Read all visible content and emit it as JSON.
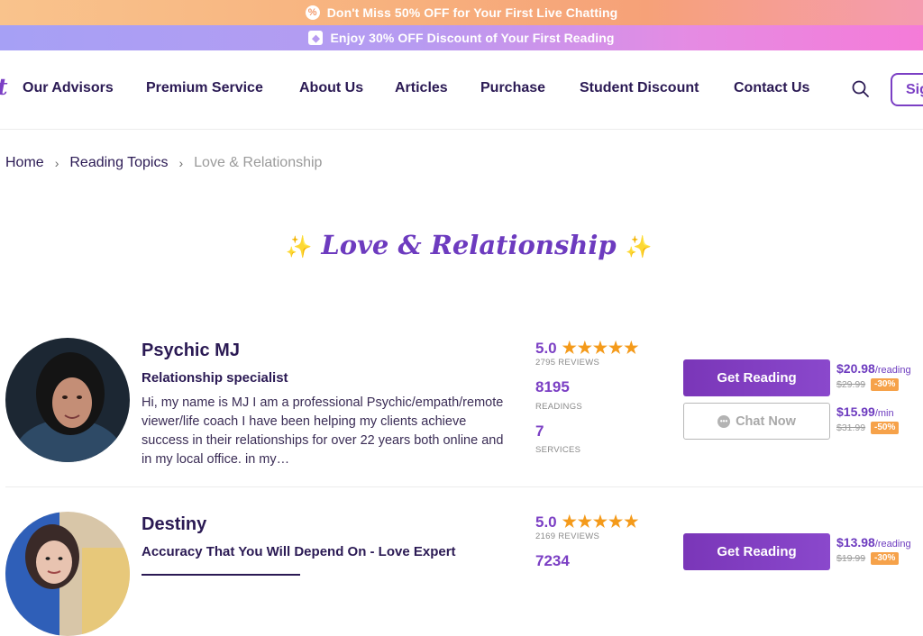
{
  "promo": {
    "line1": "Don't Miss 50% OFF for Your First Live Chatting",
    "line2": "Enjoy 30% OFF Discount of Your First Reading"
  },
  "nav": {
    "logo_fragment": "t",
    "items": [
      "Our Advisors",
      "Premium Service",
      "About Us",
      "Articles",
      "Purchase",
      "Student Discount",
      "Contact Us"
    ],
    "signin_label": "Sig"
  },
  "breadcrumb": {
    "items": [
      "Home",
      "Reading Topics",
      "Love & Relationship"
    ],
    "separator": "›"
  },
  "page": {
    "title": "Love & Relationship"
  },
  "advisors": [
    {
      "name": "Psychic MJ",
      "tagline": "Relationship specialist",
      "description": "Hi, my name is MJ I am a professional Psychic/empath/remote viewer/life coach I have been helping my clients achieve success in their relationships for over 22 years both online and in my local office. in my…",
      "rating": "5.0",
      "reviews": "2795 REVIEWS",
      "readings": "8195",
      "readings_label": "READINGS",
      "services": "7",
      "services_label": "SERVICES",
      "get_reading_label": "Get Reading",
      "reading_price": "$20.98",
      "reading_unit": "/reading",
      "reading_old_price": "$29.99",
      "reading_discount": "-30%",
      "chat_label": "Chat Now",
      "chat_price": "$15.99",
      "chat_unit": "/min",
      "chat_old_price": "$31.99",
      "chat_discount": "-50%"
    },
    {
      "name": "Destiny",
      "tagline": "Accuracy That You Will Depend On - Love Expert",
      "rating": "5.0",
      "reviews": "2169 REVIEWS",
      "readings": "7234",
      "get_reading_label": "Get Reading",
      "reading_price": "$13.98",
      "reading_unit": "/reading",
      "reading_old_price": "$19.99",
      "reading_discount": "-30%"
    }
  ],
  "colors": {
    "accent": "#7b3fc4",
    "nav_text": "#2b1a54",
    "star": "#f49a1a",
    "discount_badge": "#f6a24a"
  }
}
